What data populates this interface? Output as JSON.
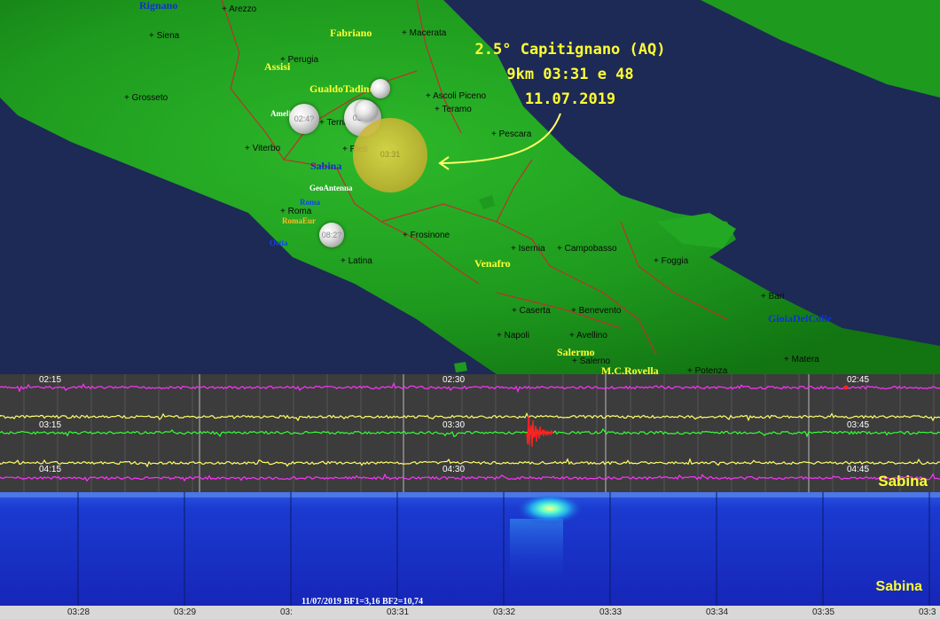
{
  "event": {
    "line1": "2.5°  Capitignano (AQ)",
    "line2": "9km 03:31 e 48",
    "line3": "11.07.2019"
  },
  "map": {
    "cities": [
      "Arezzo",
      "Siena",
      "Macerata",
      "Perugia",
      "Grosseto",
      "Ascoli Piceno",
      "Teramo",
      "Terni",
      "Viterbo",
      "Pescara",
      "Rieti",
      "Roma",
      "Latina",
      "Frosinone",
      "Isernia",
      "Campobasso",
      "Foggia",
      "Bari",
      "Caserta",
      "Benevento",
      "Napoli",
      "Avellino",
      "Salerno",
      "Potenza",
      "Matera"
    ],
    "stations": {
      "rignano": "Rignano",
      "fabriano": "Fabriano",
      "assisi": "Assisi",
      "gualdotadino": "GualdoTadino",
      "amelia": "Amelia",
      "sabina": "Sabina",
      "geoantenna": "GeoAntenna",
      "roma": "Roma",
      "romaeur": "RomaEur",
      "ostia": "Ostia",
      "venafro": "Venafro",
      "salerno": "Salermo",
      "mcrovella": "M.C.Rovella",
      "gioiadelcolle": "GioiaDelColle"
    },
    "quakes": [
      "02:4?",
      "03:27",
      "08:2?",
      "03:31"
    ],
    "colors": {
      "land": "#1f9e1f",
      "sea": "#1d2a55",
      "border": "#c0302a",
      "event": "#ffff33"
    }
  },
  "seismogram": {
    "row_labels": {
      "r1_left": "02:15",
      "r1_mid": "02:30",
      "r1_right": "02:45",
      "r2_left": "03:15",
      "r2_mid": "03:30",
      "r2_right": "03:45",
      "r3_left": "04:15",
      "r3_mid": "04:30",
      "r3_right": "04:45"
    },
    "station": "Sabina",
    "colors": {
      "magenta": "#ff33ff",
      "yellow": "#ffff66",
      "green": "#33ff33",
      "event": "#ff2222"
    }
  },
  "spectrogram": {
    "station": "Sabina",
    "caption": "11/07/2019 BF1=3,16 BF2=10,74",
    "x_ticks": [
      "03:28",
      "03:29",
      "03:",
      "03:31",
      "03:32",
      "03:33",
      "03:34",
      "03:35",
      "03:3"
    ]
  }
}
